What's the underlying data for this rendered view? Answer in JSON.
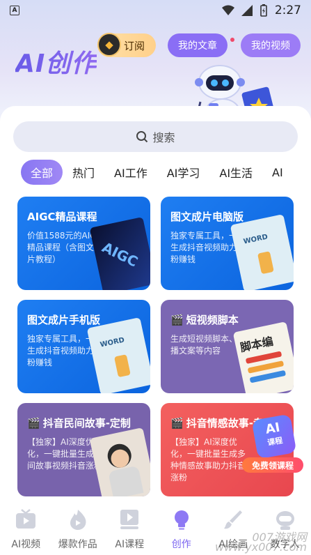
{
  "status_bar": {
    "time": "2:27"
  },
  "header": {
    "app_title": "AI创作",
    "subscribe_label": "订阅",
    "my_articles_label": "我的文章",
    "my_videos_label": "我的视频"
  },
  "search": {
    "label": "搜索"
  },
  "tabs": [
    "全部",
    "热门",
    "AI工作",
    "AI学习",
    "AI生活",
    "AI"
  ],
  "cards": [
    {
      "title": "AIGC精品课程",
      "desc": "价值1588元的AIGC精品课程（含图文成片教程）",
      "thumb_text": "AIGC"
    },
    {
      "title": "图文成片电脑版",
      "desc": "独家专属工具，一键生成抖音视频助力涨粉赚钱",
      "thumb_text": "WORD"
    },
    {
      "title": "图文成片手机版",
      "desc": "独家专属工具，一键生成抖音视频助力涨粉赚钱",
      "thumb_text": "WORD"
    },
    {
      "title": "短视频脚本",
      "desc": "生成短视频脚本、口播文案等内容",
      "thumb_text": "脚本编"
    },
    {
      "title": "抖音民间故事-定制",
      "desc": "【独家】AI深度优化，一键批量生成民间故事视频抖音涨粉"
    },
    {
      "title": "抖音情感故事-专",
      "desc": "【独家】AI深度优化，一键批量生成多种情感故事助力抖音涨粉",
      "badge_top": "AI",
      "badge_bottom": "课程",
      "badge_banner": "免费领课程"
    }
  ],
  "bottom_nav": [
    {
      "label": "AI视频",
      "icon": "tv-icon"
    },
    {
      "label": "爆款作品",
      "icon": "flame-icon"
    },
    {
      "label": "AI课程",
      "icon": "play-course-icon"
    },
    {
      "label": "创作",
      "icon": "bulb-icon"
    },
    {
      "label": "AI绘画",
      "icon": "brush-icon"
    },
    {
      "label": "数字人",
      "icon": "robot-icon"
    }
  ],
  "watermark": "007游戏网\nwww.yx007.com",
  "colors": {
    "accent": "#7a63f0",
    "blue_card": "#1a74ea",
    "purple_card": "#7b67b3",
    "red_card": "#f05858"
  }
}
